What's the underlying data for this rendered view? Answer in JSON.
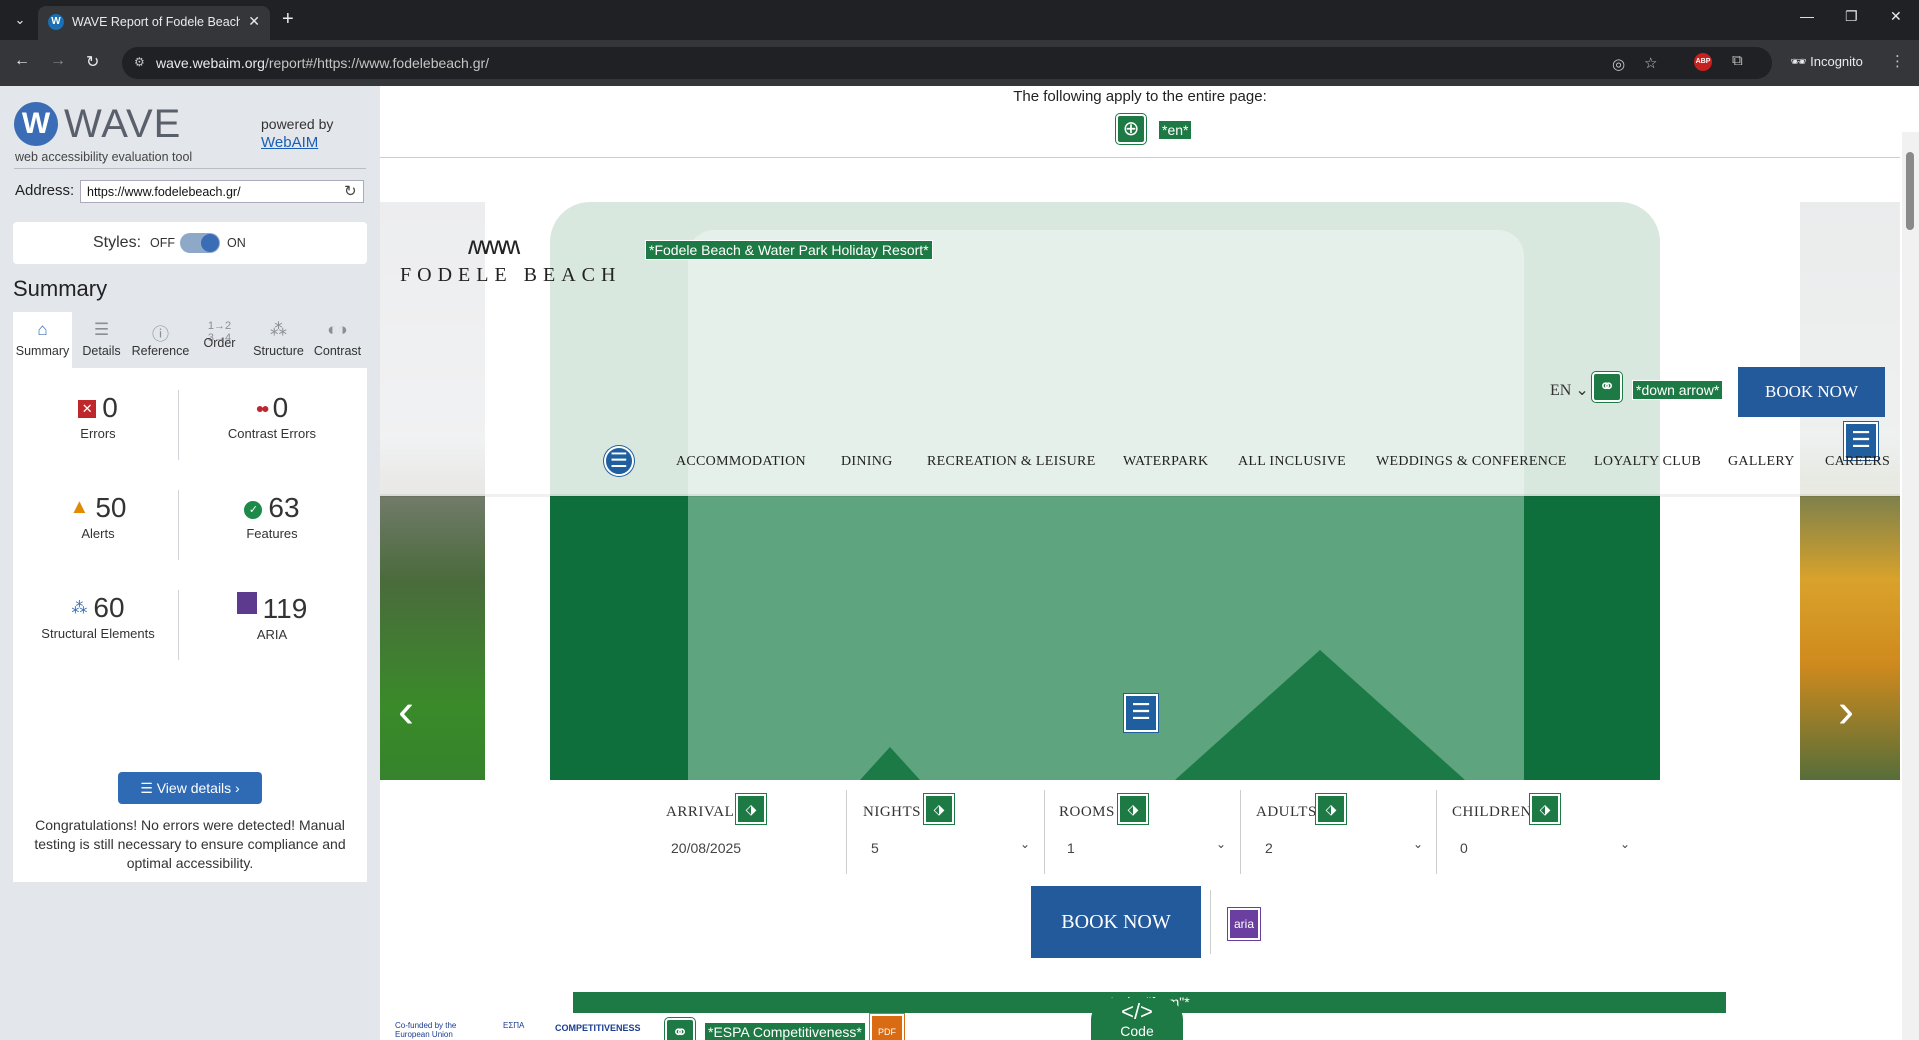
{
  "browser": {
    "tab_title": "WAVE Report of Fodele Beach H",
    "url_host": "wave.webaim.org",
    "url_path": "/report#/https://www.fodelebeach.gr/",
    "incognito_label": "Incognito",
    "abp_label": "ABP"
  },
  "wave": {
    "logo_letter": "W",
    "title": "WAVE",
    "subtitle": "web accessibility evaluation tool",
    "powered_by": "powered by",
    "webaim_link": "WebAIM",
    "address_label": "Address:",
    "address_value": "https://www.fodelebeach.gr/",
    "styles_label": "Styles:",
    "styles_off": "OFF",
    "styles_on": "ON",
    "styles_enabled": true,
    "summary_heading": "Summary",
    "tabs": [
      {
        "label": "Summary",
        "icon": "home-icon",
        "active": true
      },
      {
        "label": "Details",
        "icon": "list-icon",
        "active": false
      },
      {
        "label": "Reference",
        "icon": "info-icon",
        "active": false
      },
      {
        "label": "Order",
        "icon": "order-icon",
        "active": false
      },
      {
        "label": "Structure",
        "icon": "structure-icon",
        "active": false
      },
      {
        "label": "Contrast",
        "icon": "contrast-icon",
        "active": false
      }
    ],
    "stats": {
      "errors": {
        "value": "0",
        "label": "Errors"
      },
      "contrast_errors": {
        "value": "0",
        "label": "Contrast Errors"
      },
      "alerts": {
        "value": "50",
        "label": "Alerts"
      },
      "features": {
        "value": "63",
        "label": "Features"
      },
      "structural": {
        "value": "60",
        "label": "Structural Elements"
      },
      "aria": {
        "value": "119",
        "label": "ARIA"
      }
    },
    "view_details": "View details ›",
    "congrats": "Congratulations! No errors were detected! Manual testing is still necessary to ensure compliance and optimal accessibility."
  },
  "page": {
    "apply_text": "The following apply to the entire page:",
    "lang_badge": "*en*",
    "site_title_badge": "*Fodele Beach & Water Park Holiday Resort*",
    "logo_alt_badge": "*Fodele Beach & Water Park Holiday Resort*",
    "logo_text": "FODELE BEACH",
    "lang_select": "EN",
    "down_arrow_badge": "*down arrow*",
    "book_now_top": "BOOK NOW",
    "nav": [
      "ACCOMMODATION",
      "DINING",
      "RECREATION & LEISURE",
      "WATERPARK",
      "ALL INCLUSIVE",
      "WEDDINGS & CONFERENCE",
      "LOYALTY CLUB",
      "GALLERY",
      "CAREERS"
    ],
    "booking": {
      "arrival_label": "ARRIVAL",
      "arrival_value": "20/08/2025",
      "nights_label": "NIGHTS",
      "nights_value": "5",
      "rooms_label": "ROOMS",
      "rooms_value": "1",
      "adults_label": "ADULTS",
      "adults_value": "2",
      "children_label": "CHILDREN",
      "children_value": "0"
    },
    "book_now_main": "BOOK NOW",
    "aria_badge": "aria",
    "role_form": "*role=\"form\"*",
    "espa_badge": "*ESPA Competitiveness*",
    "eu_logo_text": "Co-funded by the European Union",
    "espa_text": "ΕΣΠΑ",
    "competitiveness_text": "COMPETITIVENESS",
    "code_label": "Code",
    "code_symbol": "</>"
  }
}
